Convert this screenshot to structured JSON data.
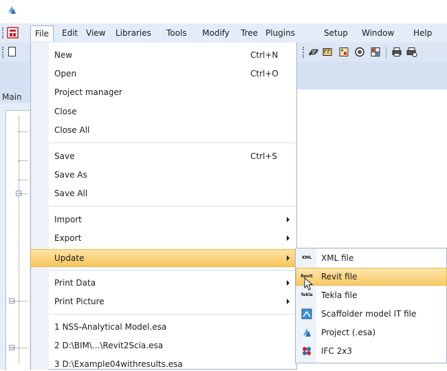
{
  "menubar": {
    "items": [
      {
        "label": "File"
      },
      {
        "label": "Edit"
      },
      {
        "label": "View"
      },
      {
        "label": "Libraries"
      },
      {
        "label": "Tools"
      },
      {
        "label": "Modify"
      },
      {
        "label": "Tree"
      },
      {
        "label": "Plugins"
      },
      {
        "label": "Setup"
      },
      {
        "label": "Window"
      },
      {
        "label": "Help"
      }
    ]
  },
  "left_panel": {
    "tab_label": "Main"
  },
  "file_menu": {
    "new": {
      "label": "New",
      "shortcut": "Ctrl+N"
    },
    "open": {
      "label": "Open",
      "shortcut": "Ctrl+O"
    },
    "project_manager": {
      "label": "Project manager"
    },
    "close": {
      "label": "Close"
    },
    "close_all": {
      "label": "Close All"
    },
    "save": {
      "label": "Save",
      "shortcut": "Ctrl+S"
    },
    "save_as": {
      "label": "Save As"
    },
    "save_all": {
      "label": "Save All"
    },
    "import": {
      "label": "Import"
    },
    "export": {
      "label": "Export"
    },
    "update": {
      "label": "Update"
    },
    "print_data": {
      "label": "Print Data"
    },
    "print_picture": {
      "label": "Print Picture"
    },
    "recent": [
      {
        "label": "1 NSS-Analytical Model.esa"
      },
      {
        "label": "2 D:\\BIM\\...\\Revit2Scia.esa"
      },
      {
        "label": "3 D:\\Example04withresults.esa"
      }
    ]
  },
  "update_submenu": {
    "items": [
      {
        "label": "XML file",
        "icon_text": "XML"
      },
      {
        "label": "Revit file",
        "icon_text": "Revit"
      },
      {
        "label": "Tekla file",
        "icon_text": "Tekla"
      },
      {
        "label": "Scaffolder model IT file"
      },
      {
        "label": "Project (.esa)"
      },
      {
        "label": "IFC 2x3"
      }
    ]
  },
  "colors": {
    "highlight": "#f6c55f",
    "menubar": "#e3ecf7",
    "toolbar": "#dbe5f3"
  }
}
